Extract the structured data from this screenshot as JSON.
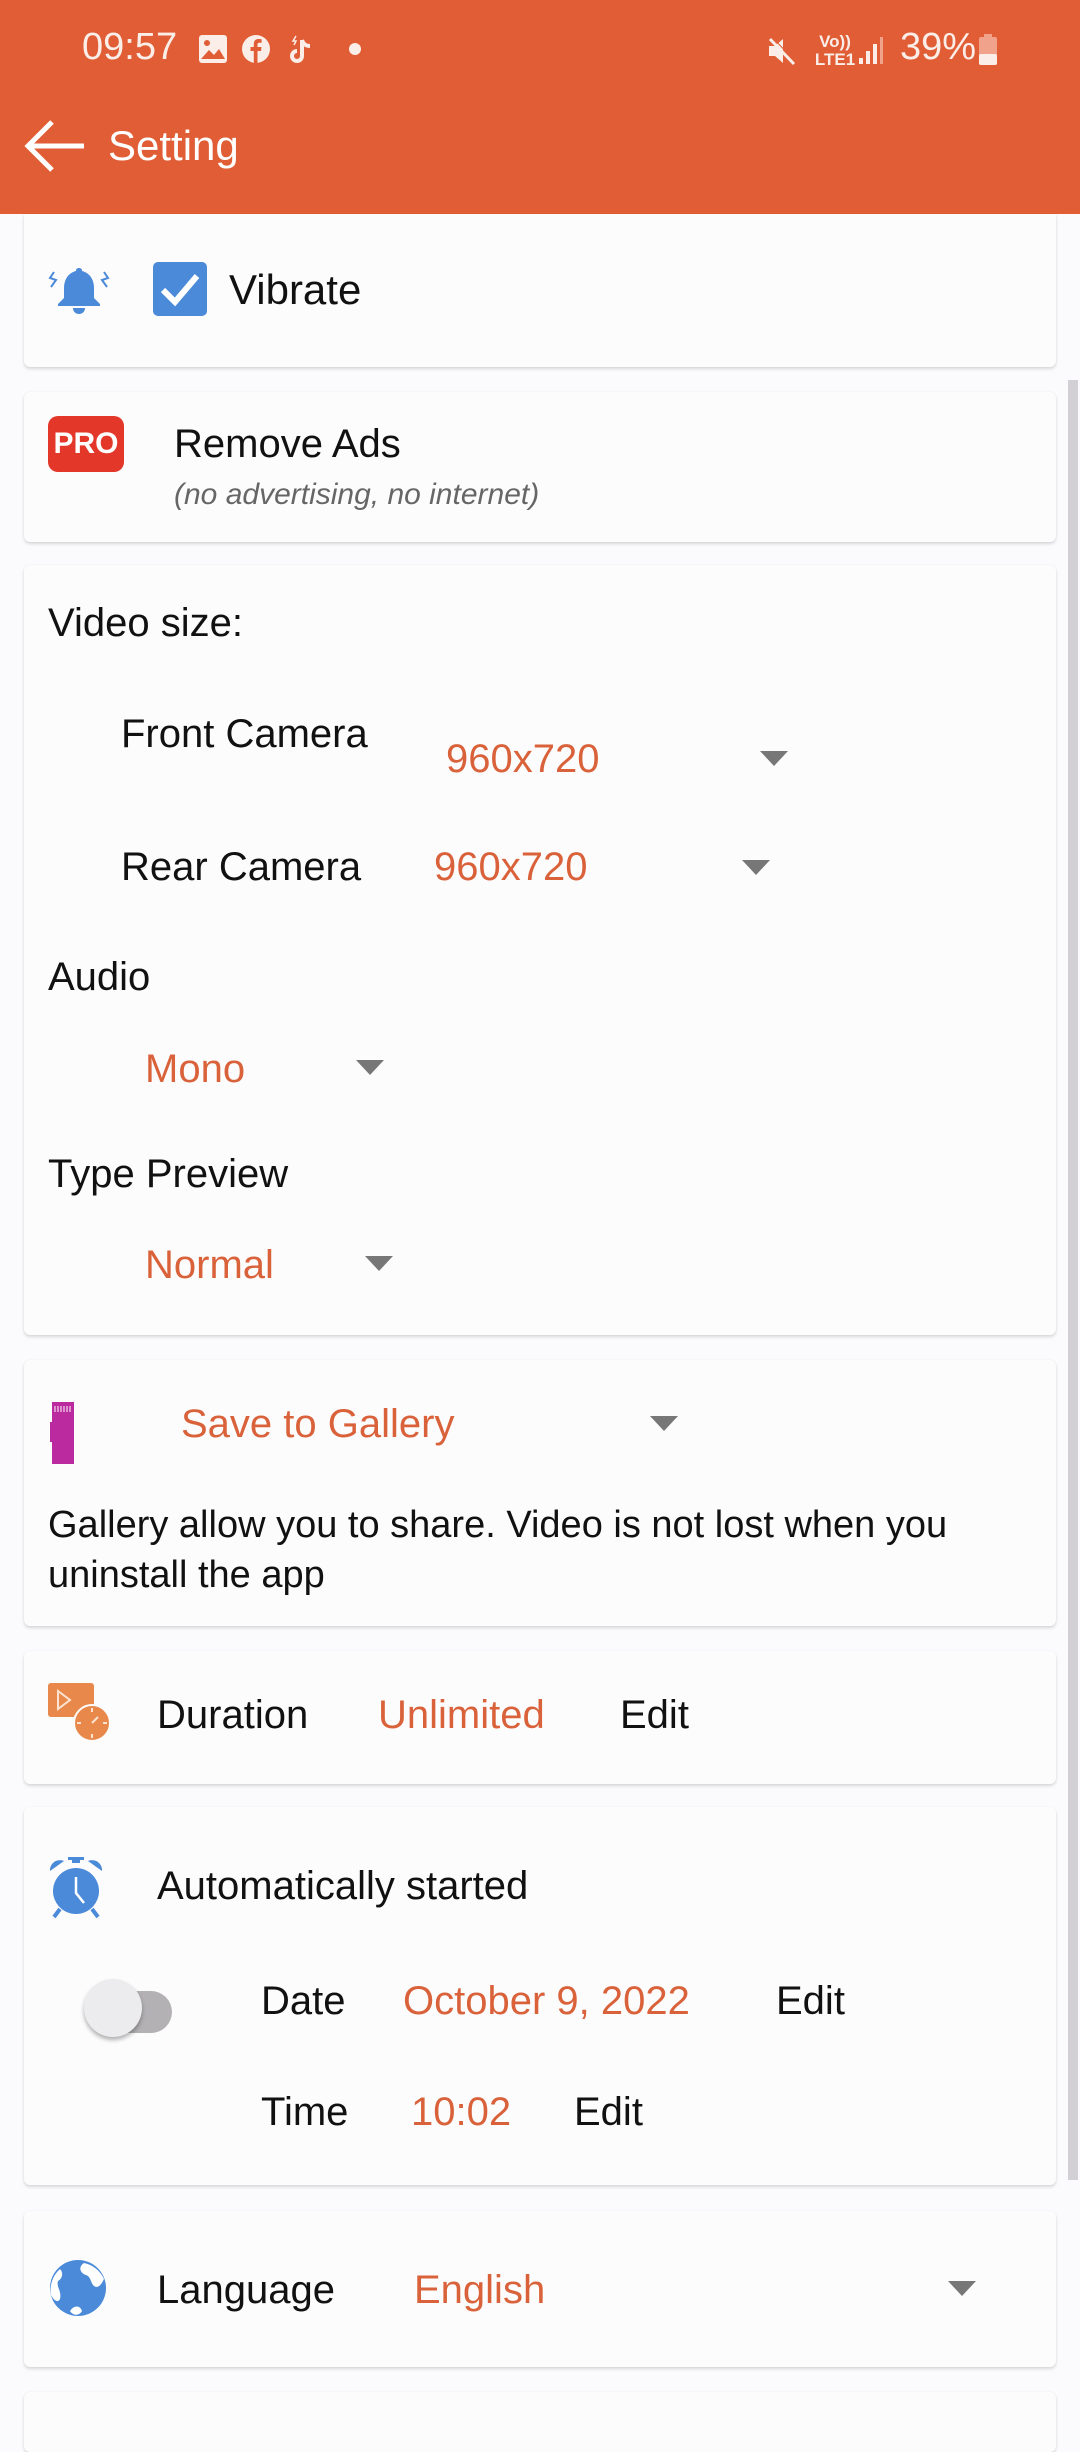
{
  "status_bar": {
    "time": "09:57",
    "notification_icons": [
      "gallery-icon",
      "facebook-icon",
      "tiktok-icon",
      "dot-icon"
    ],
    "system_icons": [
      "mute-icon",
      "volte-lte-icon",
      "signal-icon"
    ],
    "volte_label_top": "Vo))",
    "volte_label_bottom": "LTE1",
    "battery": "39%",
    "battery_level": 0.39
  },
  "appbar": {
    "title": "Setting",
    "back_icon": "arrow-left-icon"
  },
  "colors": {
    "accent": "#E05D35",
    "value": "#D9623B",
    "icon_blue": "#4A8AD9",
    "pro_red": "#E3372A",
    "sd_magenta": "#BB2A9E",
    "duration_orange": "#E8884A"
  },
  "vibrate": {
    "icon": "vibrate-bell-icon",
    "label": "Vibrate",
    "checked": true
  },
  "remove_ads": {
    "badge": "PRO",
    "label": "Remove Ads",
    "subtitle": "(no advertising, no internet)"
  },
  "video": {
    "section_label": "Video size:",
    "front_label": "Front Camera",
    "front_value": "960x720",
    "rear_label": "Rear Camera",
    "rear_value": "960x720",
    "audio_label": "Audio",
    "audio_value": "Mono",
    "preview_label": "Type Preview",
    "preview_value": "Normal"
  },
  "storage": {
    "icon": "sd-card-icon",
    "value": "Save to Gallery",
    "description": "Gallery allow you to share. Video is not lost when you uninstall the app"
  },
  "duration": {
    "icon": "video-timer-icon",
    "label": "Duration",
    "value": "Unlimited",
    "edit": "Edit"
  },
  "auto_start": {
    "icon": "alarm-clock-icon",
    "label": "Automatically started",
    "enabled": false,
    "date_label": "Date",
    "date_value": "October 9, 2022",
    "date_edit": "Edit",
    "time_label": "Time",
    "time_value": "10:02",
    "time_edit": "Edit"
  },
  "language": {
    "icon": "globe-icon",
    "label": "Language",
    "value": "English"
  }
}
